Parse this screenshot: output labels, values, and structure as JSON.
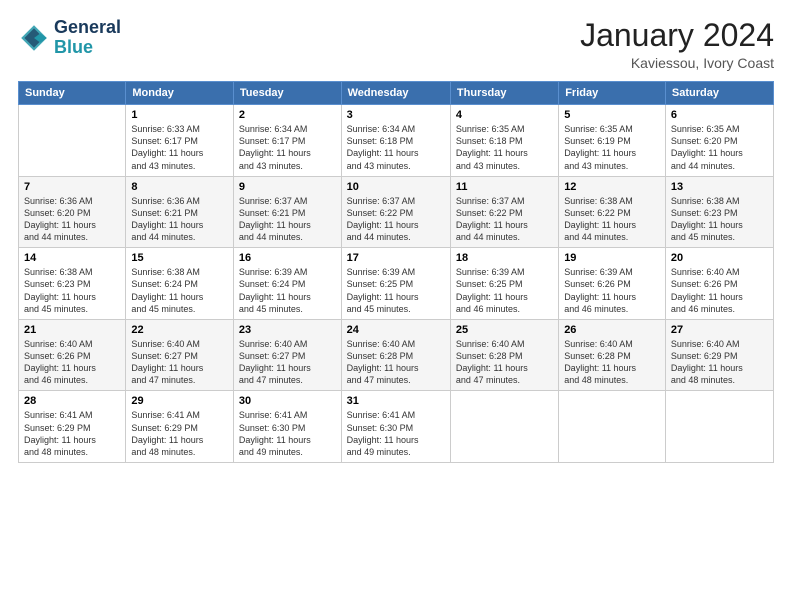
{
  "header": {
    "logo_line1": "General",
    "logo_line2": "Blue",
    "title": "January 2024",
    "subtitle": "Kaviessou, Ivory Coast"
  },
  "weekdays": [
    "Sunday",
    "Monday",
    "Tuesday",
    "Wednesday",
    "Thursday",
    "Friday",
    "Saturday"
  ],
  "weeks": [
    [
      {
        "num": "",
        "info": ""
      },
      {
        "num": "1",
        "info": "Sunrise: 6:33 AM\nSunset: 6:17 PM\nDaylight: 11 hours\nand 43 minutes."
      },
      {
        "num": "2",
        "info": "Sunrise: 6:34 AM\nSunset: 6:17 PM\nDaylight: 11 hours\nand 43 minutes."
      },
      {
        "num": "3",
        "info": "Sunrise: 6:34 AM\nSunset: 6:18 PM\nDaylight: 11 hours\nand 43 minutes."
      },
      {
        "num": "4",
        "info": "Sunrise: 6:35 AM\nSunset: 6:18 PM\nDaylight: 11 hours\nand 43 minutes."
      },
      {
        "num": "5",
        "info": "Sunrise: 6:35 AM\nSunset: 6:19 PM\nDaylight: 11 hours\nand 43 minutes."
      },
      {
        "num": "6",
        "info": "Sunrise: 6:35 AM\nSunset: 6:20 PM\nDaylight: 11 hours\nand 44 minutes."
      }
    ],
    [
      {
        "num": "7",
        "info": "Sunrise: 6:36 AM\nSunset: 6:20 PM\nDaylight: 11 hours\nand 44 minutes."
      },
      {
        "num": "8",
        "info": "Sunrise: 6:36 AM\nSunset: 6:21 PM\nDaylight: 11 hours\nand 44 minutes."
      },
      {
        "num": "9",
        "info": "Sunrise: 6:37 AM\nSunset: 6:21 PM\nDaylight: 11 hours\nand 44 minutes."
      },
      {
        "num": "10",
        "info": "Sunrise: 6:37 AM\nSunset: 6:22 PM\nDaylight: 11 hours\nand 44 minutes."
      },
      {
        "num": "11",
        "info": "Sunrise: 6:37 AM\nSunset: 6:22 PM\nDaylight: 11 hours\nand 44 minutes."
      },
      {
        "num": "12",
        "info": "Sunrise: 6:38 AM\nSunset: 6:22 PM\nDaylight: 11 hours\nand 44 minutes."
      },
      {
        "num": "13",
        "info": "Sunrise: 6:38 AM\nSunset: 6:23 PM\nDaylight: 11 hours\nand 45 minutes."
      }
    ],
    [
      {
        "num": "14",
        "info": "Sunrise: 6:38 AM\nSunset: 6:23 PM\nDaylight: 11 hours\nand 45 minutes."
      },
      {
        "num": "15",
        "info": "Sunrise: 6:38 AM\nSunset: 6:24 PM\nDaylight: 11 hours\nand 45 minutes."
      },
      {
        "num": "16",
        "info": "Sunrise: 6:39 AM\nSunset: 6:24 PM\nDaylight: 11 hours\nand 45 minutes."
      },
      {
        "num": "17",
        "info": "Sunrise: 6:39 AM\nSunset: 6:25 PM\nDaylight: 11 hours\nand 45 minutes."
      },
      {
        "num": "18",
        "info": "Sunrise: 6:39 AM\nSunset: 6:25 PM\nDaylight: 11 hours\nand 46 minutes."
      },
      {
        "num": "19",
        "info": "Sunrise: 6:39 AM\nSunset: 6:26 PM\nDaylight: 11 hours\nand 46 minutes."
      },
      {
        "num": "20",
        "info": "Sunrise: 6:40 AM\nSunset: 6:26 PM\nDaylight: 11 hours\nand 46 minutes."
      }
    ],
    [
      {
        "num": "21",
        "info": "Sunrise: 6:40 AM\nSunset: 6:26 PM\nDaylight: 11 hours\nand 46 minutes."
      },
      {
        "num": "22",
        "info": "Sunrise: 6:40 AM\nSunset: 6:27 PM\nDaylight: 11 hours\nand 47 minutes."
      },
      {
        "num": "23",
        "info": "Sunrise: 6:40 AM\nSunset: 6:27 PM\nDaylight: 11 hours\nand 47 minutes."
      },
      {
        "num": "24",
        "info": "Sunrise: 6:40 AM\nSunset: 6:28 PM\nDaylight: 11 hours\nand 47 minutes."
      },
      {
        "num": "25",
        "info": "Sunrise: 6:40 AM\nSunset: 6:28 PM\nDaylight: 11 hours\nand 47 minutes."
      },
      {
        "num": "26",
        "info": "Sunrise: 6:40 AM\nSunset: 6:28 PM\nDaylight: 11 hours\nand 48 minutes."
      },
      {
        "num": "27",
        "info": "Sunrise: 6:40 AM\nSunset: 6:29 PM\nDaylight: 11 hours\nand 48 minutes."
      }
    ],
    [
      {
        "num": "28",
        "info": "Sunrise: 6:41 AM\nSunset: 6:29 PM\nDaylight: 11 hours\nand 48 minutes."
      },
      {
        "num": "29",
        "info": "Sunrise: 6:41 AM\nSunset: 6:29 PM\nDaylight: 11 hours\nand 48 minutes."
      },
      {
        "num": "30",
        "info": "Sunrise: 6:41 AM\nSunset: 6:30 PM\nDaylight: 11 hours\nand 49 minutes."
      },
      {
        "num": "31",
        "info": "Sunrise: 6:41 AM\nSunset: 6:30 PM\nDaylight: 11 hours\nand 49 minutes."
      },
      {
        "num": "",
        "info": ""
      },
      {
        "num": "",
        "info": ""
      },
      {
        "num": "",
        "info": ""
      }
    ]
  ]
}
